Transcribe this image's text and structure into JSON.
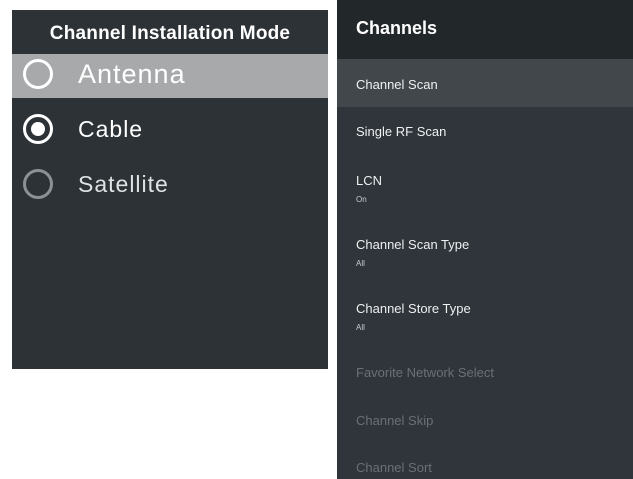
{
  "mode_panel": {
    "title": "Channel Installation Mode",
    "options": [
      {
        "label": "Antenna",
        "state": "unchecked",
        "focused": true
      },
      {
        "label": "Cable",
        "state": "checked",
        "focused": false
      },
      {
        "label": "Satellite",
        "state": "unchecked",
        "focused": false
      }
    ]
  },
  "channels_panel": {
    "title": "Channels",
    "items": [
      {
        "label": "Channel Scan",
        "value": "",
        "focused": true,
        "enabled": true
      },
      {
        "label": "Single RF Scan",
        "value": "",
        "focused": false,
        "enabled": true
      },
      {
        "label": "LCN",
        "value": "On",
        "focused": false,
        "enabled": true
      },
      {
        "label": "Channel Scan Type",
        "value": "All",
        "focused": false,
        "enabled": true
      },
      {
        "label": "Channel Store Type",
        "value": "All",
        "focused": false,
        "enabled": true
      },
      {
        "label": "Favorite Network Select",
        "value": "",
        "focused": false,
        "enabled": false
      },
      {
        "label": "Channel Skip",
        "value": "",
        "focused": false,
        "enabled": false
      },
      {
        "label": "Channel Sort",
        "value": "",
        "focused": false,
        "enabled": false
      }
    ]
  },
  "colors": {
    "panel_background": "#2c3236",
    "focus_highlight": "#a7a9aa",
    "channels_header": "#22272a",
    "disabled_text": "#6a7074"
  }
}
